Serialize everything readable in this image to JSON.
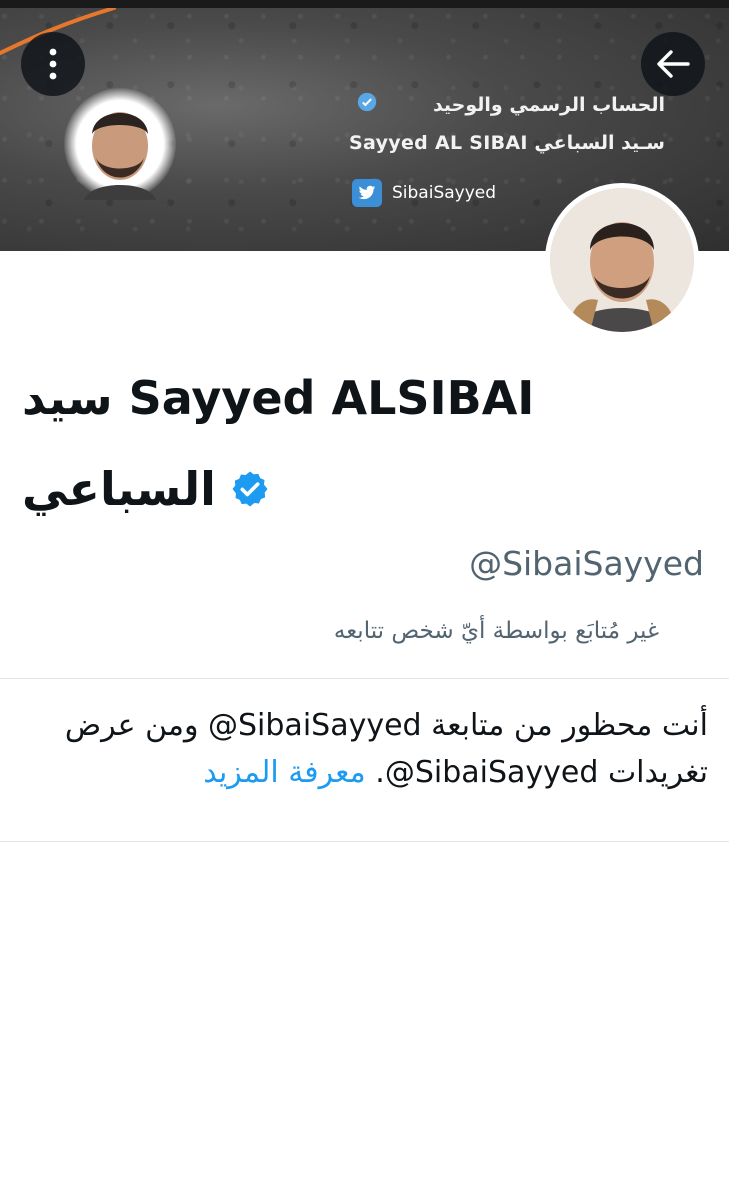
{
  "banner": {
    "line1": "الحساب الرسمي والوحيد",
    "line2": "سـيد السباعي  Sayyed AL SIBAI",
    "twitter_handle": "SibaiSayyed"
  },
  "header": {
    "back_icon": "arrow-left-icon",
    "more_icon": "more-vertical-icon"
  },
  "profile": {
    "display_name_line1": "سيد Sayyed ALSIBAI",
    "display_name_line2": "السباعي",
    "handle": "@SibaiSayyed",
    "followed_by": "غير مُتابَع بواسطة أيّ شخص تتابعه",
    "verified_color": "#1d9bf0"
  },
  "blocked_notice": {
    "text": "أنت محظور من متابعة ‎@SibaiSayyed‏ ومن عرض تغريدات ‎@SibaiSayyed‏.",
    "learn_more": "معرفة المزيد"
  }
}
